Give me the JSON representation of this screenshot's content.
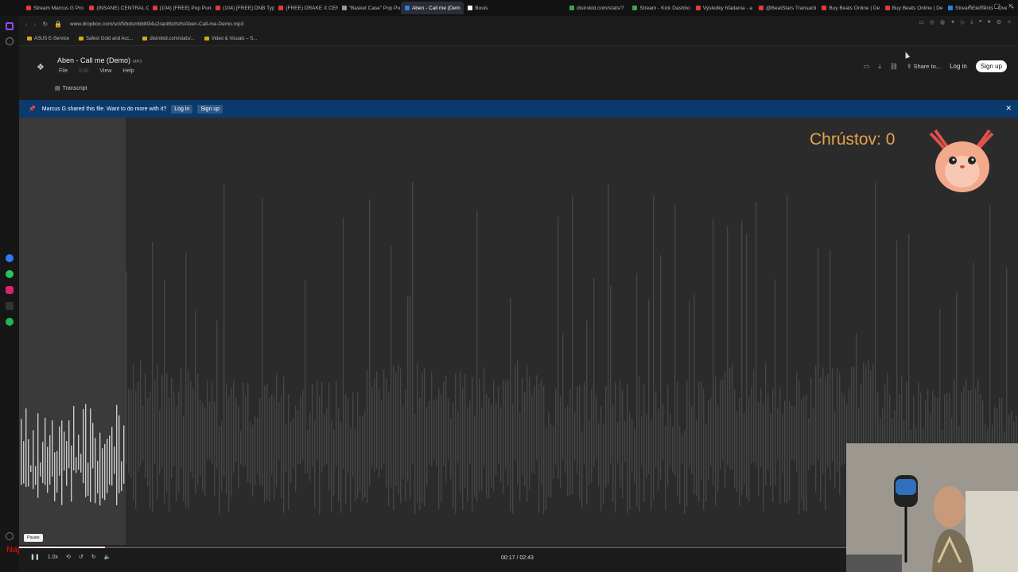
{
  "browser": {
    "tabs": [
      {
        "label": "Stream Marcus G Pro",
        "color": "#e53935"
      },
      {
        "label": "(INSANE) CENTRAL CE",
        "color": "#e53935"
      },
      {
        "label": "(104) [FREE] Pop Puni",
        "color": "#e53935"
      },
      {
        "label": "(104) [FREE] DNB Typ",
        "color": "#e53935"
      },
      {
        "label": "(FREE) DRAKE X CENT",
        "color": "#e53935"
      },
      {
        "label": "\"Basket Case\" Pop Pu",
        "color": "#999999"
      },
      {
        "label": "Aben - Call me (Dem",
        "color": "#1e88e5",
        "active": true
      },
      {
        "label": "Bouis",
        "color": "#ffffff"
      },
      {
        "label": "distrokid.com/stats/?",
        "color": "#43a047"
      },
      {
        "label": "Stream - Kick Dashbo",
        "color": "#43a047"
      },
      {
        "label": "Výsledky hľadania - a",
        "color": "#e53935"
      },
      {
        "label": "@BeatStars Transacti",
        "color": "#e53935"
      },
      {
        "label": "Buy Beats Online | De",
        "color": "#e53935"
      },
      {
        "label": "Buy Beats Online | De",
        "color": "#e53935"
      },
      {
        "label": "StreamElements - Ove",
        "color": "#1e88e5"
      }
    ],
    "url": "www.dropbox.com/scl/fi/bdsmbb8l34u2rao8bzhzh/Aben-Call-me-Demo.mp3",
    "bookmarks": [
      "ASUS E-Service",
      "Safest Gold and Acc...",
      "distrokid.com/stats/...",
      "Video & Visuals – S..."
    ]
  },
  "file": {
    "title": "Aben - Call me (Demo)",
    "ext": "MP3",
    "menu": [
      "File",
      "Edit",
      "View",
      "Help"
    ],
    "transcript": "Transcript"
  },
  "header": {
    "share": "Share to...",
    "login": "Log in",
    "signup": "Sign up"
  },
  "banner": {
    "message": "Marcus G shared this file. Want to do more with it?",
    "login": "Log in",
    "signup": "Sign up"
  },
  "overlay": {
    "counter": "Chrústov: 0",
    "red_text": "Najnovší Chrust:"
  },
  "player": {
    "pause_tooltip": "Pause",
    "speed": "1.0x",
    "time": "00:17 / 02:43",
    "progress": 0.104
  },
  "colors": {
    "banner": "#0a3a6e",
    "counter": "#e6a24a"
  }
}
